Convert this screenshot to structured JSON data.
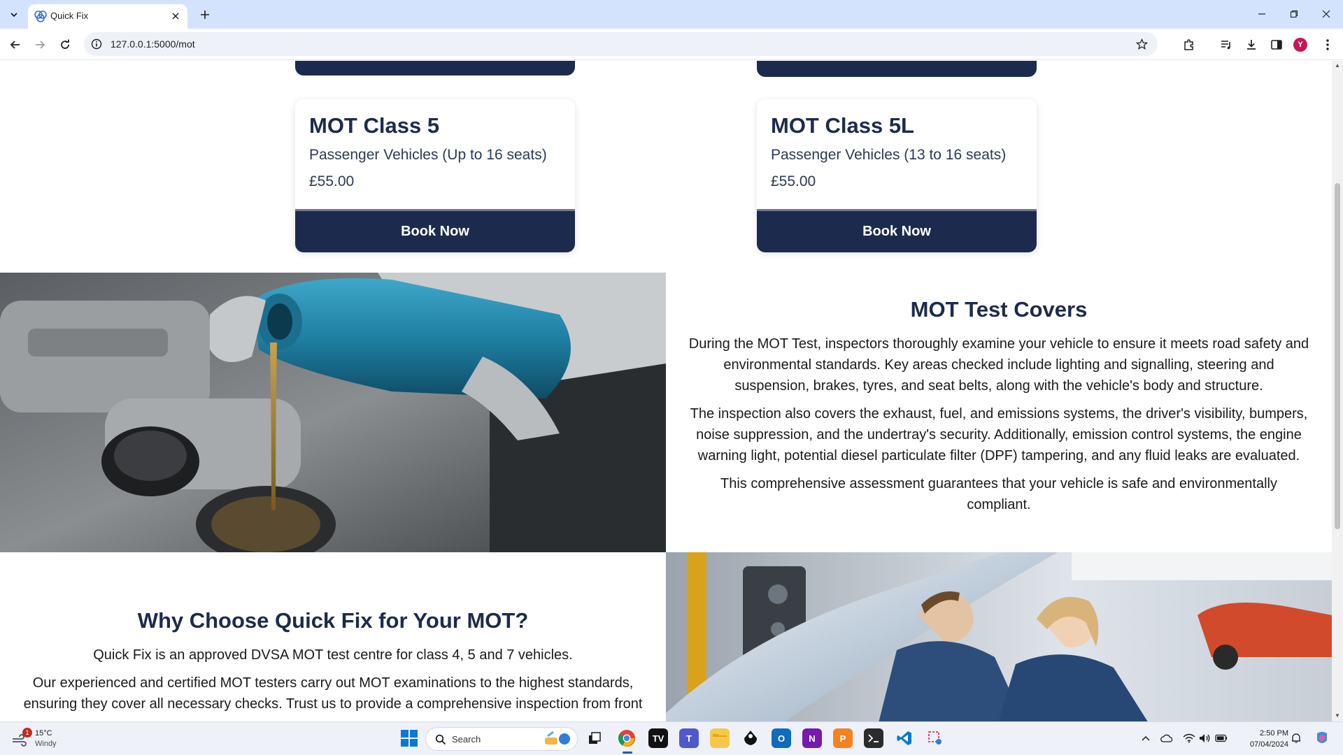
{
  "browser": {
    "tab_title": "Quick Fix",
    "url": "127.0.0.1:5000/mot"
  },
  "cards": [
    {
      "title": "MOT Class 5",
      "description": "Passenger Vehicles (Up to 16 seats)",
      "price": "£55.00",
      "button": "Book Now"
    },
    {
      "title": "MOT Class 5L",
      "description": "Passenger Vehicles (13 to 16 seats)",
      "price": "£55.00",
      "button": "Book Now"
    }
  ],
  "covers": {
    "heading": "MOT Test Covers",
    "paragraphs": [
      "During the MOT Test, inspectors thoroughly examine your vehicle to ensure it meets road safety and environmental standards. Key areas checked include lighting and signalling, steering and suspension, brakes, tyres, and seat belts, along with the vehicle's body and structure.",
      "The inspection also covers the exhaust, fuel, and emissions systems, the driver's visibility, bumpers, noise suppression, and the undertray's security. Additionally, emission control systems, the engine warning light, potential diesel particulate filter (DPF) tampering, and any fluid leaks are evaluated.",
      "This comprehensive assessment guarantees that your vehicle is safe and environmentally compliant."
    ]
  },
  "why": {
    "heading": "Why Choose Quick Fix for Your MOT?",
    "paragraphs": [
      "Quick Fix is an approved DVSA MOT test centre for class 4, 5 and 7 vehicles.",
      "Our experienced and certified MOT testers carry out MOT examinations to the highest standards, ensuring they cover all necessary checks. Trust us to provide a comprehensive inspection from front"
    ]
  },
  "taskbar": {
    "weather_temp": "15°C",
    "weather_condition": "Windy",
    "weather_badge": "1",
    "search_label": "Search",
    "time": "2:50 PM",
    "date": "07/04/2024"
  },
  "profile_initial": "Y",
  "colors": {
    "navy": "#1c2b4d",
    "tabbar": "#d3e3fd",
    "taskbar": "#eef1f8"
  }
}
